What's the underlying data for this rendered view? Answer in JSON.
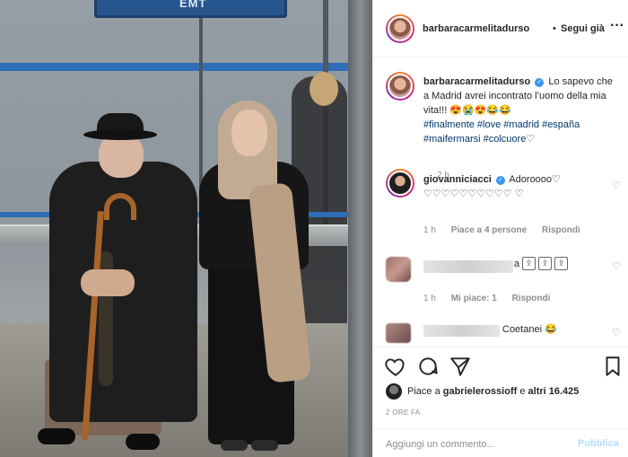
{
  "header": {
    "username": "barbaracarmelitadurso",
    "separator": "•",
    "follow_label": "Segui già",
    "more_label": "···"
  },
  "photo": {
    "sign_text": "EMT"
  },
  "caption": {
    "username": "barbaracarmelitadurso",
    "text": "Lo sapevo che a Madrid avrei incontrato l’uomo della mia vita!!! 😍😭😍😂😂",
    "hashtags": "#finalmente #love #madrid #españa #maifermarsi #colcuore♡",
    "time": "2 h"
  },
  "comments": [
    {
      "username": "giovanniciacci",
      "text": "Adoroooo♡ ♡♡♡♡♡♡♡♡♡♡ ♡",
      "time": "1 h",
      "likes": "Piace a 4 persone",
      "reply": "Rispondi"
    },
    {
      "letter": "a",
      "time": "1 h",
      "likes": "Mi piace: 1",
      "reply": "Rispondi"
    },
    {
      "text": "Coetanei 😂"
    }
  ],
  "likes": {
    "prefix": "Piace a ",
    "user": "gabrielerossioff",
    "suffix": " e ",
    "others": "altri 16.425"
  },
  "post_time": "2 ORE FA",
  "add_comment": {
    "placeholder": "Aggiungi un commento...",
    "publish_label": "Pubblica"
  },
  "colors": {
    "link": "#00376b",
    "publish_disabled": "#b2dffc",
    "verified": "#3897f0",
    "muted": "#8e8e8e"
  }
}
